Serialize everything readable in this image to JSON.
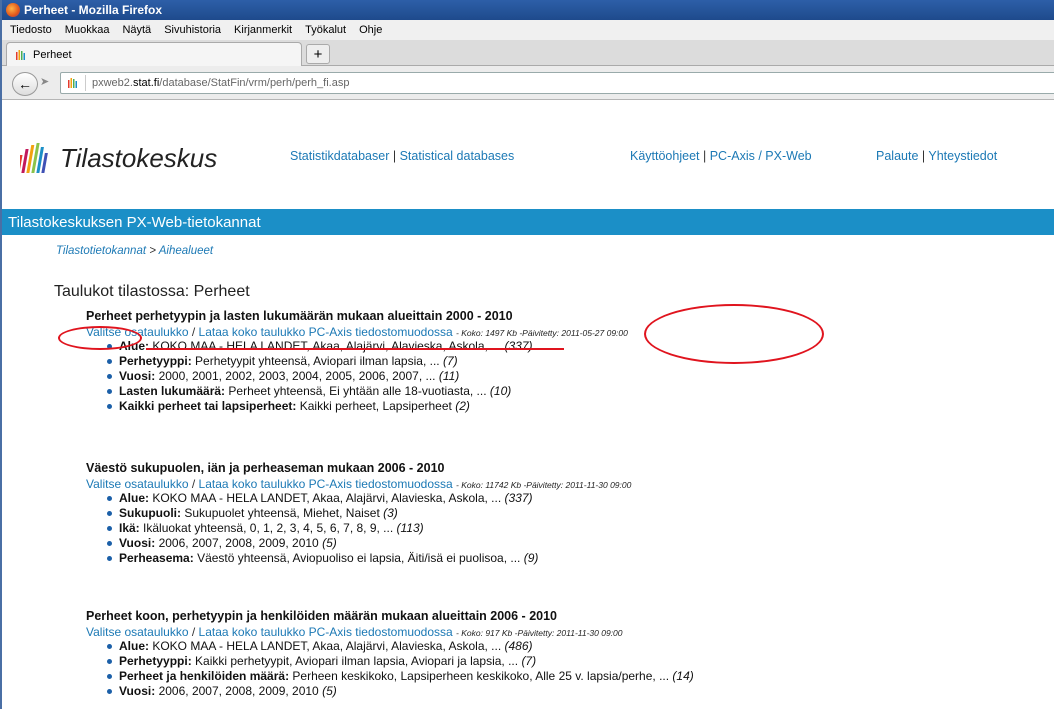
{
  "window": {
    "title": "Perheet - Mozilla Firefox"
  },
  "menu": [
    "Tiedosto",
    "Muokkaa",
    "Näytä",
    "Sivuhistoria",
    "Kirjanmerkit",
    "Työkalut",
    "Ohje"
  ],
  "tab": {
    "label": "Perheet",
    "new_tab": "+"
  },
  "nav": {
    "url_prefix": "pxweb2.",
    "url_domain": "stat.fi",
    "url_path": "/database/StatFin/vrm/perh/perh_fi.asp"
  },
  "site": {
    "logo": "Tilastokeskus",
    "links": {
      "statistikdatabaser": "Statistikdatabaser",
      "statistical": "Statistical databases",
      "kayttoohjeet": "Käyttöohjeet",
      "pcaxis": "PC-Axis / PX-Web",
      "palaute": "Palaute",
      "yhteystiedot": "Yhteystiedot"
    },
    "pipe": "|",
    "banner": "Tilastokeskuksen PX-Web-tietokannat",
    "crumb1": "Tilastotietokannat",
    "crumb_sep": ">",
    "crumb2": "Aihealueet",
    "page_title": "Taulukot tilastossa: Perheet"
  },
  "common": {
    "select": "Valitse osataulukko",
    "slash": "/",
    "download": "Lataa koko taulukko PC-Axis tiedostomuodossa"
  },
  "sections": [
    {
      "title": "Perheet perhetyypin ja lasten lukumäärän mukaan alueittain 2000 - 2010",
      "meta": "- Koko: 1497 Kb -Päivitetty: 2011-05-27 09:00",
      "items": [
        {
          "k": "Alue:",
          "v": "KOKO MAA - HELA LANDET, Akaa, Alajärvi, Alavieska, Askola, ...",
          "n": "(337)"
        },
        {
          "k": "Perhetyyppi:",
          "v": "Perhetyypit yhteensä, Aviopari ilman lapsia, ...",
          "n": "(7)"
        },
        {
          "k": "Vuosi:",
          "v": "2000, 2001, 2002, 2003, 2004, 2005, 2006, 2007, ...",
          "n": "(11)"
        },
        {
          "k": "Lasten lukumäärä:",
          "v": "Perheet yhteensä, Ei yhtään alle 18-vuotiasta, ...",
          "n": "(10)"
        },
        {
          "k": "Kaikki perheet tai lapsiperheet:",
          "v": "Kaikki perheet, Lapsiperheet",
          "n": "(2)"
        }
      ]
    },
    {
      "title": "Väestö sukupuolen, iän ja perheaseman mukaan 2006 - 2010",
      "meta": "- Koko: 11742 Kb -Päivitetty: 2011-11-30 09:00",
      "items": [
        {
          "k": "Alue:",
          "v": "KOKO MAA - HELA LANDET, Akaa, Alajärvi, Alavieska, Askola, ...",
          "n": "(337)"
        },
        {
          "k": "Sukupuoli:",
          "v": "Sukupuolet yhteensä, Miehet, Naiset",
          "n": "(3)"
        },
        {
          "k": "Ikä:",
          "v": "Ikäluokat yhteensä, 0, 1, 2, 3, 4, 5, 6, 7, 8, 9, ...",
          "n": "(113)"
        },
        {
          "k": "Vuosi:",
          "v": "2006, 2007, 2008, 2009, 2010",
          "n": "(5)"
        },
        {
          "k": "Perheasema:",
          "v": "Väestö yhteensä, Aviopuoliso ei lapsia, Äiti/isä ei puolisoa, ...",
          "n": "(9)"
        }
      ]
    },
    {
      "title": "Perheet koon, perhetyypin ja henkilöiden määrän mukaan alueittain 2006 - 2010",
      "meta": "- Koko: 917 Kb -Päivitetty: 2011-11-30 09:00",
      "items": [
        {
          "k": "Alue:",
          "v": "KOKO MAA - HELA LANDET, Akaa, Alajärvi, Alavieska, Askola, ...",
          "n": "(486)"
        },
        {
          "k": "Perhetyyppi:",
          "v": "Kaikki perhetyypit, Aviopari ilman lapsia, Aviopari ja lapsia, ...",
          "n": "(7)"
        },
        {
          "k": "Perheet ja henkilöiden määrä:",
          "v": "Perheen keskikoko, Lapsiperheen keskikoko, Alle 25 v. lapsia/perhe, ...",
          "n": "(14)"
        },
        {
          "k": "Vuosi:",
          "v": "2006, 2007, 2008, 2009, 2010",
          "n": "(5)"
        }
      ]
    }
  ]
}
